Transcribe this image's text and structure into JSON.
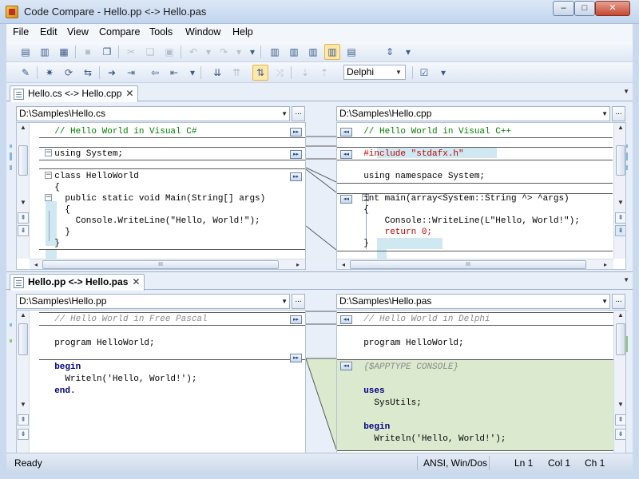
{
  "window": {
    "title": "Code Compare - Hello.pp <-> Hello.pas",
    "min": "–",
    "max": "□",
    "close": "✕"
  },
  "menu": [
    "File",
    "Edit",
    "View",
    "Compare",
    "Tools",
    "Window",
    "Help"
  ],
  "toolbar": {
    "language": "Delphi"
  },
  "panel1": {
    "tab": "Hello.cs <-> Hello.cpp",
    "tab_close": "✕",
    "left_path": "D:\\Samples\\Hello.cs",
    "right_path": "D:\\Samples\\Hello.cpp",
    "browse": "...",
    "left_lines": [
      "  // Hello World in Visual C#",
      "",
      "  using System;",
      "",
      "  class HelloWorld",
      "  {",
      "    public static void Main(String[] args)",
      "    {",
      "      Console.WriteLine(\"Hello, World!\");",
      "    }",
      "  }"
    ],
    "right_lines": [
      "  // Hello World in Visual C++",
      "",
      "  #include \"stdafx.h\"",
      "",
      "  using namespace System;",
      "",
      "  int main(array<System::String ^> ^args)",
      "  {",
      "      Console::WriteLine(L\"Hello, World!\");",
      "      return 0;",
      "  }"
    ],
    "hscroll_thumb": "III"
  },
  "panel2": {
    "tab": "Hello.pp <-> Hello.pas",
    "tab_close": "✕",
    "left_path": "D:\\Samples\\Hello.pp",
    "right_path": "D:\\Samples\\Hello.pas",
    "browse": "...",
    "left_lines": [
      "  // Hello World in Free Pascal",
      "",
      "  program HelloWorld;",
      "",
      "  begin",
      "    Writeln('Hello, World!');",
      "  end."
    ],
    "right_lines": [
      "  // Hello World in Delphi",
      "",
      "  program HelloWorld;",
      "",
      "  {$APPTYPE CONSOLE}",
      "",
      "  uses",
      "    SysUtils;",
      "",
      "  begin",
      "    Writeln('Hello, World!');"
    ],
    "hscroll_thumb": "III"
  },
  "status": {
    "ready": "Ready",
    "encoding": "ANSI, Win/Dos",
    "ln": "Ln 1",
    "col": "Col 1",
    "ch": "Ch 1"
  }
}
